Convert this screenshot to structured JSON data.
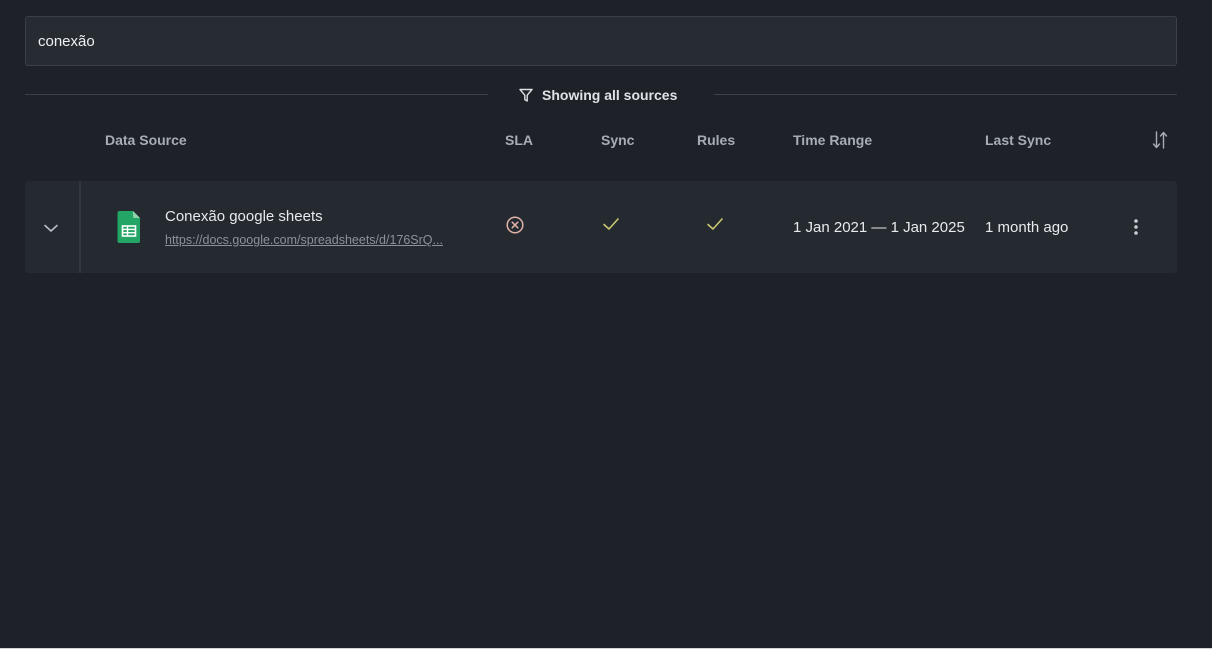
{
  "search": {
    "value": "conexão",
    "placeholder": ""
  },
  "filter": {
    "label": "Showing all sources",
    "icon": "funnel-icon"
  },
  "table": {
    "columns": {
      "data_source": "Data Source",
      "sla": "SLA",
      "sync": "Sync",
      "rules": "Rules",
      "time_range": "Time Range",
      "last_sync": "Last Sync"
    },
    "rows": [
      {
        "name": "Conexão google sheets",
        "url": "https://docs.google.com/spreadsheets/d/176SrQ...",
        "source_icon": "google-sheets-icon",
        "sla_status": "error-circle-icon",
        "sync_status": "check-icon",
        "rules_status": "check-icon",
        "time_range": "1 Jan 2021 — 1 Jan 2025",
        "last_sync": "1 month ago"
      }
    ]
  },
  "colors": {
    "background": "#1e2128",
    "row_background": "#252a31",
    "check": "#c9c86f",
    "error": "#e0b3a8",
    "sheets_green": "#23a566"
  }
}
